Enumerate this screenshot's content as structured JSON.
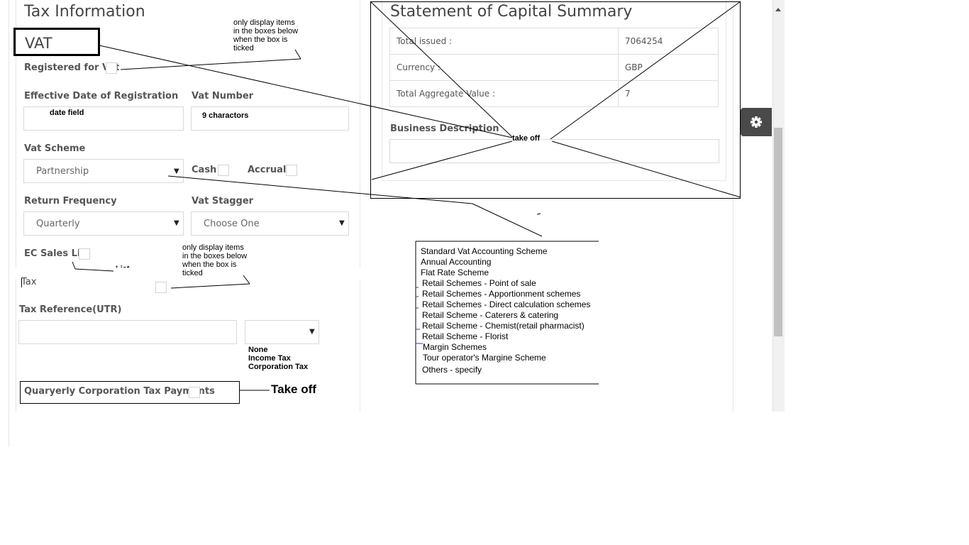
{
  "tax_info": {
    "title": "Tax Information",
    "vat_heading": "VAT",
    "registered_for_vat_label": "Registered for Vat",
    "effective_date_label": "Effective Date of Registration",
    "effective_date_value": "date field",
    "vat_number_label": "Vat Number",
    "vat_number_value": "9 charactors",
    "vat_scheme_label": "Vat Scheme",
    "vat_scheme_value": "Partnership",
    "cash_label": "Cash",
    "accrual_label": "Accrual",
    "return_frequency_label": "Return Frequency",
    "return_frequency_value": "Quarterly",
    "vat_stagger_label": "Vat Stagger",
    "vat_stagger_value": "Choose One",
    "ec_sales_label": "EC Sales Lis",
    "list_annotation": "List",
    "tax_heading": "Tax",
    "tax_reference_label": "Tax Reference(UTR)",
    "tax_type_options": [
      "None",
      "Income Tax",
      "Corporation Tax"
    ],
    "quarterly_ct_label": "Quaryerly Corporation Tax Payments",
    "take_off_bottom": "Take off"
  },
  "annotations": {
    "note_top": [
      "only display items",
      "in the boxes below",
      "when the box is",
      "ticked"
    ],
    "note_mid": [
      "only display items",
      "in the boxes below",
      "when the box is",
      "ticked"
    ]
  },
  "capital_summary": {
    "title": "Statement of Capital Summary",
    "rows": [
      {
        "label": "Total issued :",
        "value": "7064254"
      },
      {
        "label": "Currency :",
        "value": "GBP"
      },
      {
        "label": "Total Aggregate Value :",
        "value": "7"
      }
    ],
    "business_description_label": "Business Description",
    "take_off_label": "take off"
  },
  "vat_scheme_list": [
    "Standard Vat Accounting  Scheme",
    "Annual Accounting",
    "Flat Rate Scheme",
    "Retail Schemes - Point of sale",
    "Retail Schemes - Apportionment schemes",
    "Retail Schemes - Direct calculation schemes",
    "Retail Scheme - Caterers & catering",
    "Retail Scheme - Chemist(retail pharmacist)",
    "Retail Scheme - Florist",
    "Margin Schemes",
    "Tour operator's Margine Scheme",
    "Others - specify"
  ],
  "icons": {
    "settings": "gear-icon",
    "scroll_up": "scroll-up-arrow-icon"
  }
}
